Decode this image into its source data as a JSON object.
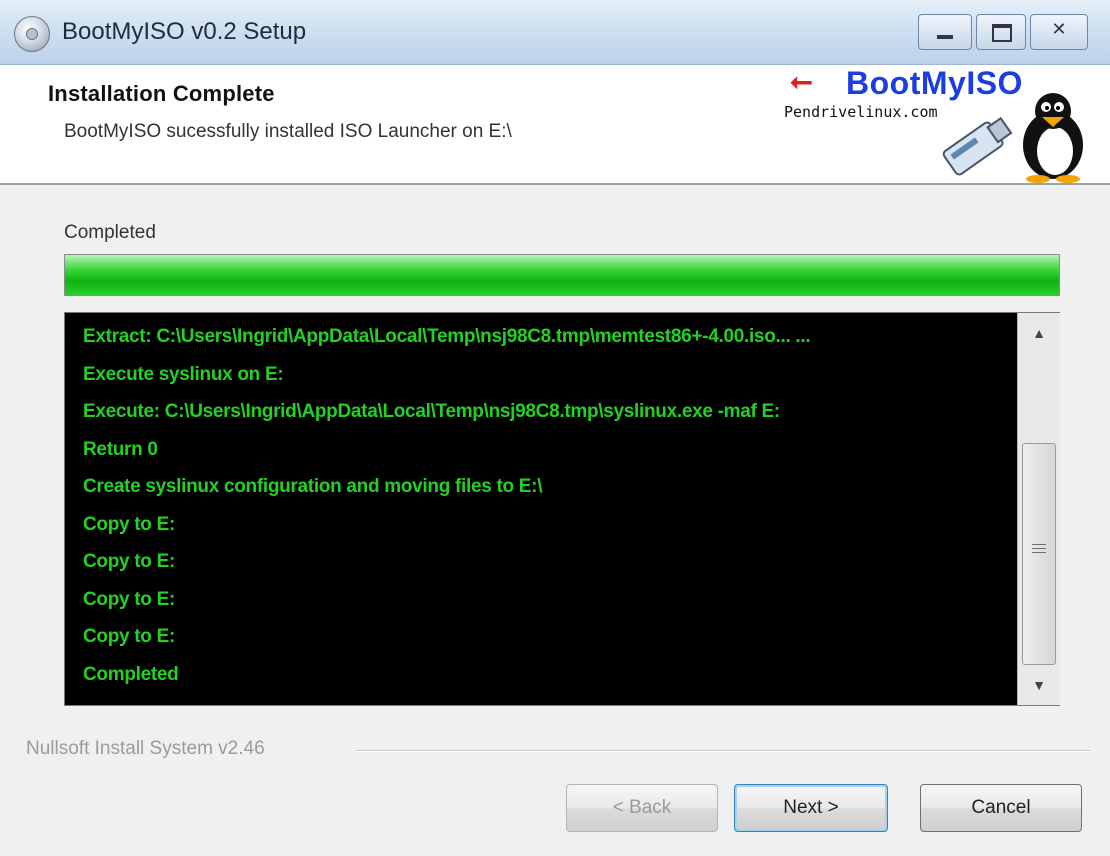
{
  "window": {
    "title": "BootMyISO v0.2 Setup",
    "controls": {
      "minimize": "minimize",
      "maximize": "maximize",
      "close": "close"
    }
  },
  "header": {
    "title": "Installation Complete",
    "subtitle": "BootMyISO sucessfully installed ISO Launcher on E:\\",
    "logo": {
      "name": "BootMyISO",
      "site": "Pendrivelinux.com"
    }
  },
  "status": {
    "label": "Completed",
    "progress_percent": 100
  },
  "log": {
    "lines": [
      "Extract: C:\\Users\\Ingrid\\AppData\\Local\\Temp\\nsj98C8.tmp\\memtest86+-4.00.iso... ...",
      "Execute syslinux on E:",
      "Execute: C:\\Users\\Ingrid\\AppData\\Local\\Temp\\nsj98C8.tmp\\syslinux.exe -maf E:",
      "Return 0",
      "Create syslinux configuration and moving files to E:\\",
      "Copy to E:",
      "Copy to E:",
      "Copy to E:",
      "Copy to E:",
      "Completed"
    ],
    "text_color": "#25d025",
    "background_color": "#000000"
  },
  "footer": {
    "branding": "Nullsoft Install System v2.46",
    "buttons": {
      "back": "< Back",
      "next": "Next >",
      "cancel": "Cancel"
    }
  },
  "colors": {
    "accent_blue": "#1a3fe0",
    "progress_green": "#0fb30f"
  }
}
